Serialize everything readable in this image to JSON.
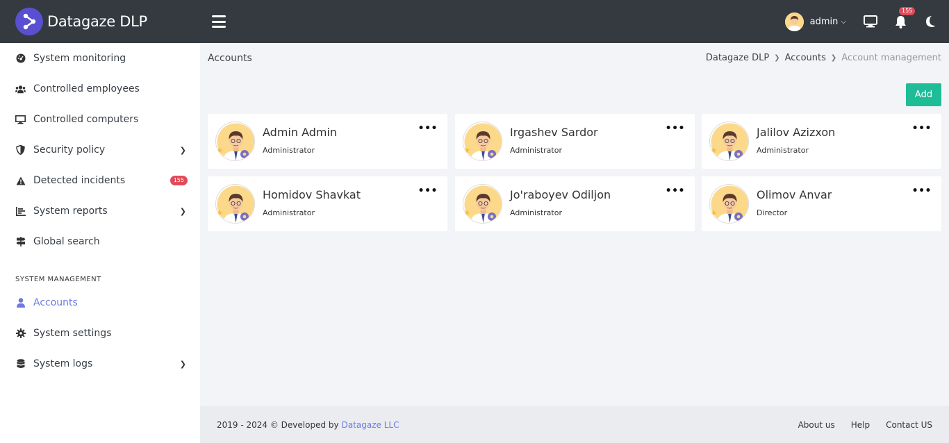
{
  "header": {
    "brand": "Datagaze DLP",
    "user_name": "admin",
    "notifications_count": "155"
  },
  "sidebar": {
    "items": [
      {
        "label": "System monitoring",
        "icon": "gauge-icon"
      },
      {
        "label": "Controlled employees",
        "icon": "users-icon"
      },
      {
        "label": "Controlled computers",
        "icon": "desktop-icon"
      },
      {
        "label": "Security policy",
        "icon": "shield-icon",
        "has_submenu": true
      },
      {
        "label": "Detected incidents",
        "icon": "warning-icon",
        "badge": "155"
      },
      {
        "label": "System reports",
        "icon": "chart-icon",
        "has_submenu": true
      },
      {
        "label": "Global search",
        "icon": "signpost-icon"
      }
    ],
    "section_title": "SYSTEM MANAGEMENT",
    "management_items": [
      {
        "label": "Accounts",
        "icon": "user-icon",
        "active": true
      },
      {
        "label": "System settings",
        "icon": "gear-icon"
      },
      {
        "label": "System logs",
        "icon": "database-icon",
        "has_submenu": true
      }
    ]
  },
  "page": {
    "title": "Accounts",
    "breadcrumb": [
      "Datagaze DLP",
      "Accounts",
      "Account management"
    ],
    "add_label": "Add"
  },
  "accounts": [
    {
      "name": "Admin Admin",
      "role": "Administrator"
    },
    {
      "name": "Irgashev Sardor",
      "role": "Administrator"
    },
    {
      "name": "Jalilov Azizxon",
      "role": "Administrator"
    },
    {
      "name": "Homidov Shavkat",
      "role": "Administrator"
    },
    {
      "name": "Jo'raboyev Odiljon",
      "role": "Administrator"
    },
    {
      "name": "Olimov Anvar",
      "role": "Director"
    }
  ],
  "footer": {
    "copyright": "2019 - 2024 © Developed by",
    "developer": "Datagaze LLC",
    "links": [
      "About us",
      "Help",
      "Contact US"
    ]
  },
  "colors": {
    "topbar": "#343a40",
    "accent": "#6c7ae0",
    "add_button": "#1ebc97",
    "badge": "#e04b5a"
  }
}
